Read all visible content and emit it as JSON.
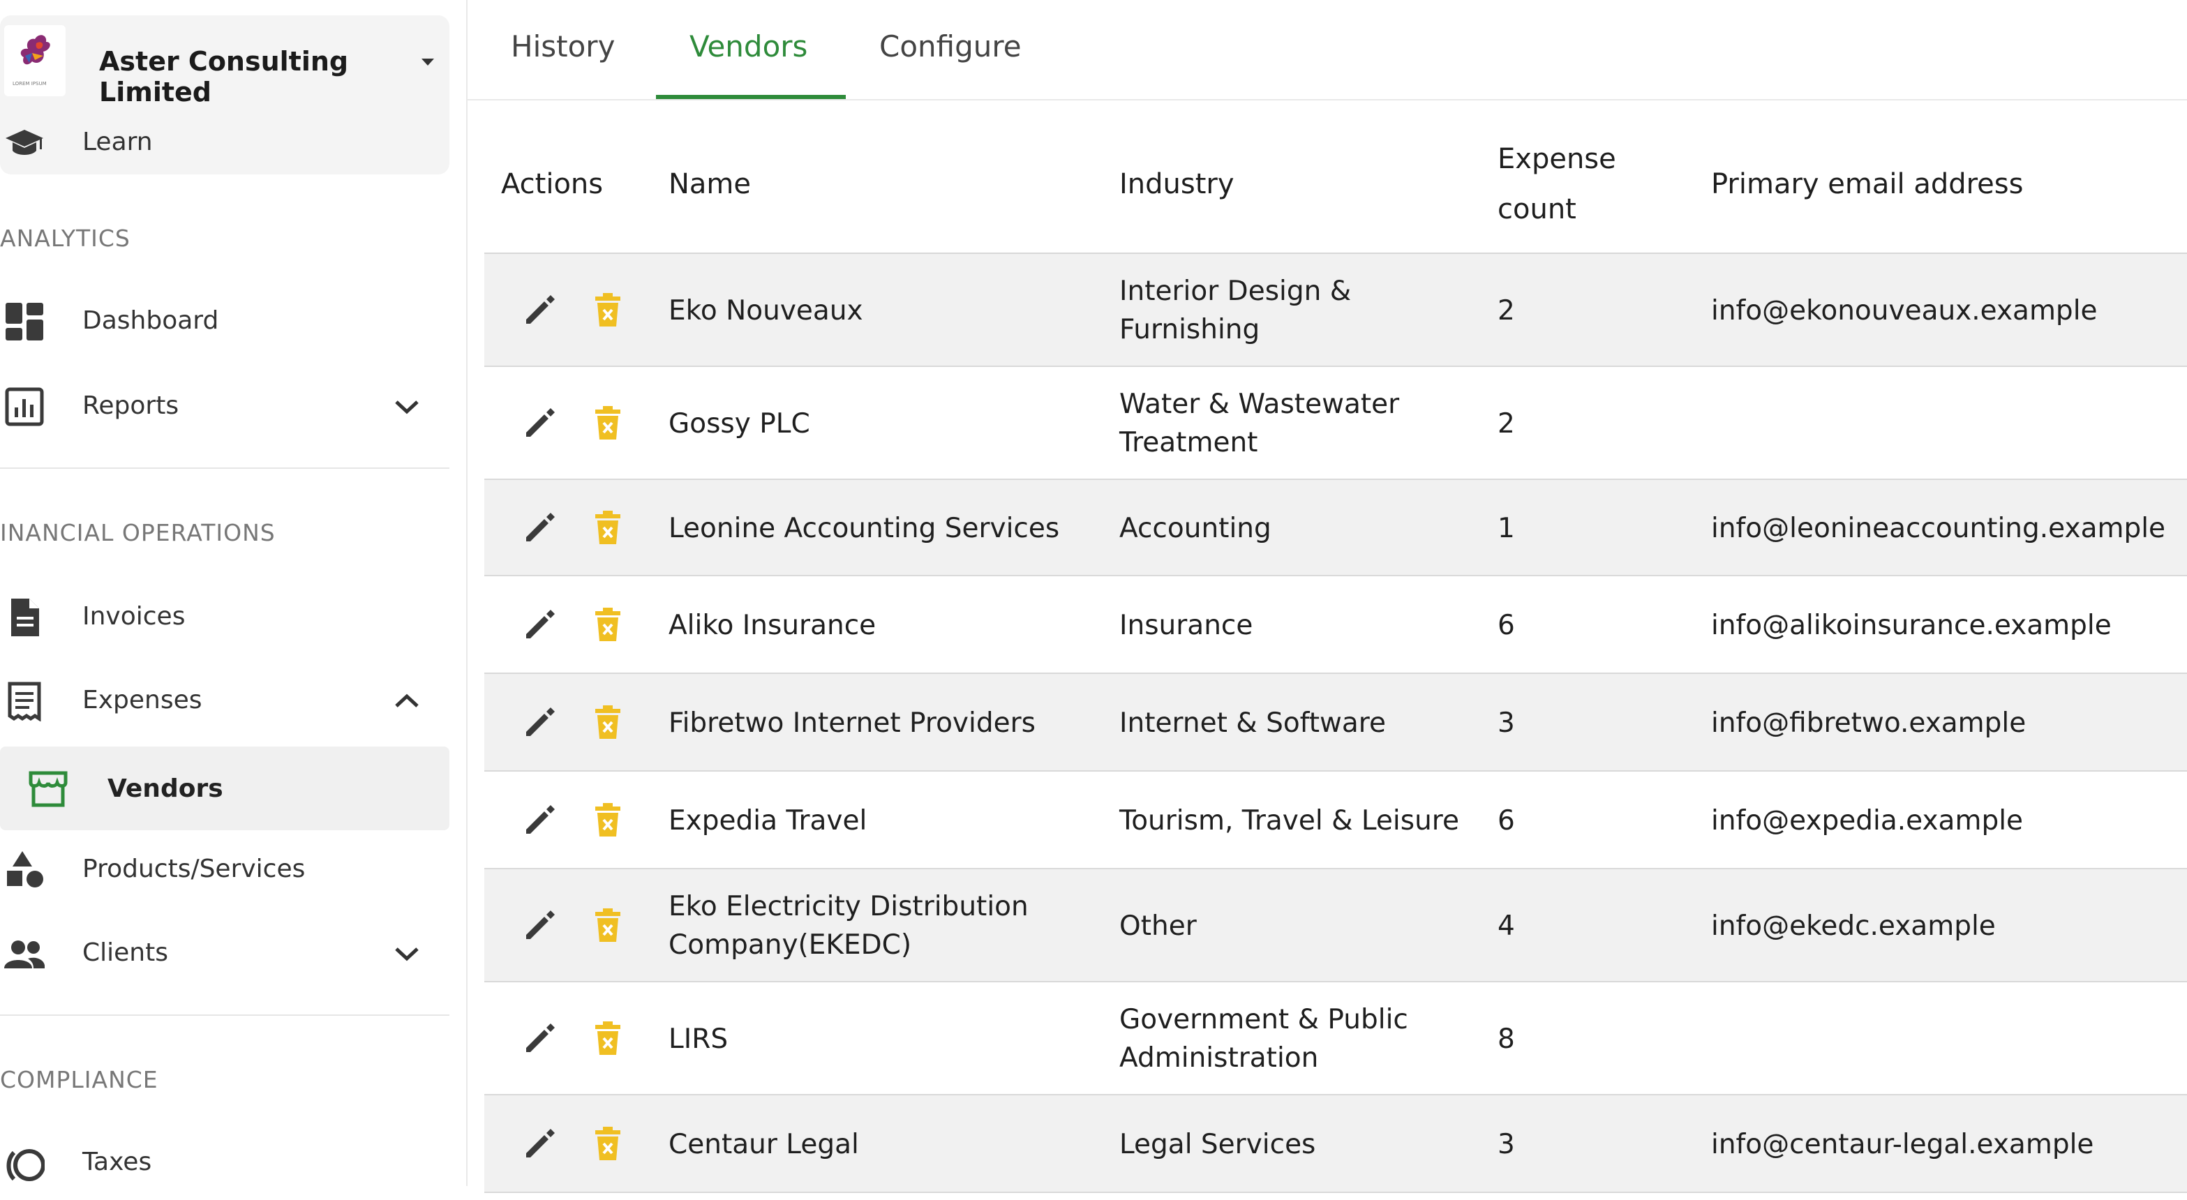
{
  "org": {
    "name": "Aster Consulting Limited",
    "logo_caption": "LOREM IPSUM",
    "logo_icon": "bird-logo"
  },
  "sidebar": {
    "learn": "Learn",
    "sections": {
      "analytics": "ANALYTICS",
      "financial": "INANCIAL OPERATIONS",
      "compliance": "COMPLIANCE"
    },
    "items": {
      "dashboard": "Dashboard",
      "reports": "Reports",
      "invoices": "Invoices",
      "expenses": "Expenses",
      "vendors": "Vendors",
      "products": "Products/Services",
      "clients": "Clients",
      "taxes": "Taxes"
    }
  },
  "tabs": {
    "history": "History",
    "vendors": "Vendors",
    "configure": "Configure",
    "active": "Vendors"
  },
  "table": {
    "headers": {
      "actions": "Actions",
      "name": "Name",
      "industry": "Industry",
      "count_line1": "Expense",
      "count_line2": "count",
      "email": "Primary email address"
    },
    "rows": [
      {
        "name": "Eko Nouveaux",
        "industry": "Interior Design & Furnishing",
        "count": "2",
        "email": "info@ekonouveaux.example"
      },
      {
        "name": "Gossy PLC",
        "industry": "Water & Wastewater Treatment",
        "count": "2",
        "email": ""
      },
      {
        "name": "Leonine Accounting Services",
        "industry": "Accounting",
        "count": "1",
        "email": "info@leonineaccounting.example"
      },
      {
        "name": "Aliko Insurance",
        "industry": "Insurance",
        "count": "6",
        "email": "info@alikoinsurance.example"
      },
      {
        "name": "Fibretwo Internet Providers",
        "industry": "Internet & Software",
        "count": "3",
        "email": "info@fibretwo.example"
      },
      {
        "name": "Expedia Travel",
        "industry": "Tourism, Travel & Leisure",
        "count": "6",
        "email": "info@expedia.example"
      },
      {
        "name": "Eko Electricity Distribution Company(EKEDC)",
        "industry": "Other",
        "count": "4",
        "email": "info@ekedc.example"
      },
      {
        "name": "LIRS",
        "industry": "Government & Public Administration",
        "count": "8",
        "email": ""
      },
      {
        "name": "Centaur Legal",
        "industry": "Legal Services",
        "count": "3",
        "email": "info@centaur-legal.example"
      }
    ]
  },
  "colors": {
    "accent": "#2e8b3a",
    "delete_icon": "#f0bf22",
    "row_alt": "#f1f1f1"
  }
}
